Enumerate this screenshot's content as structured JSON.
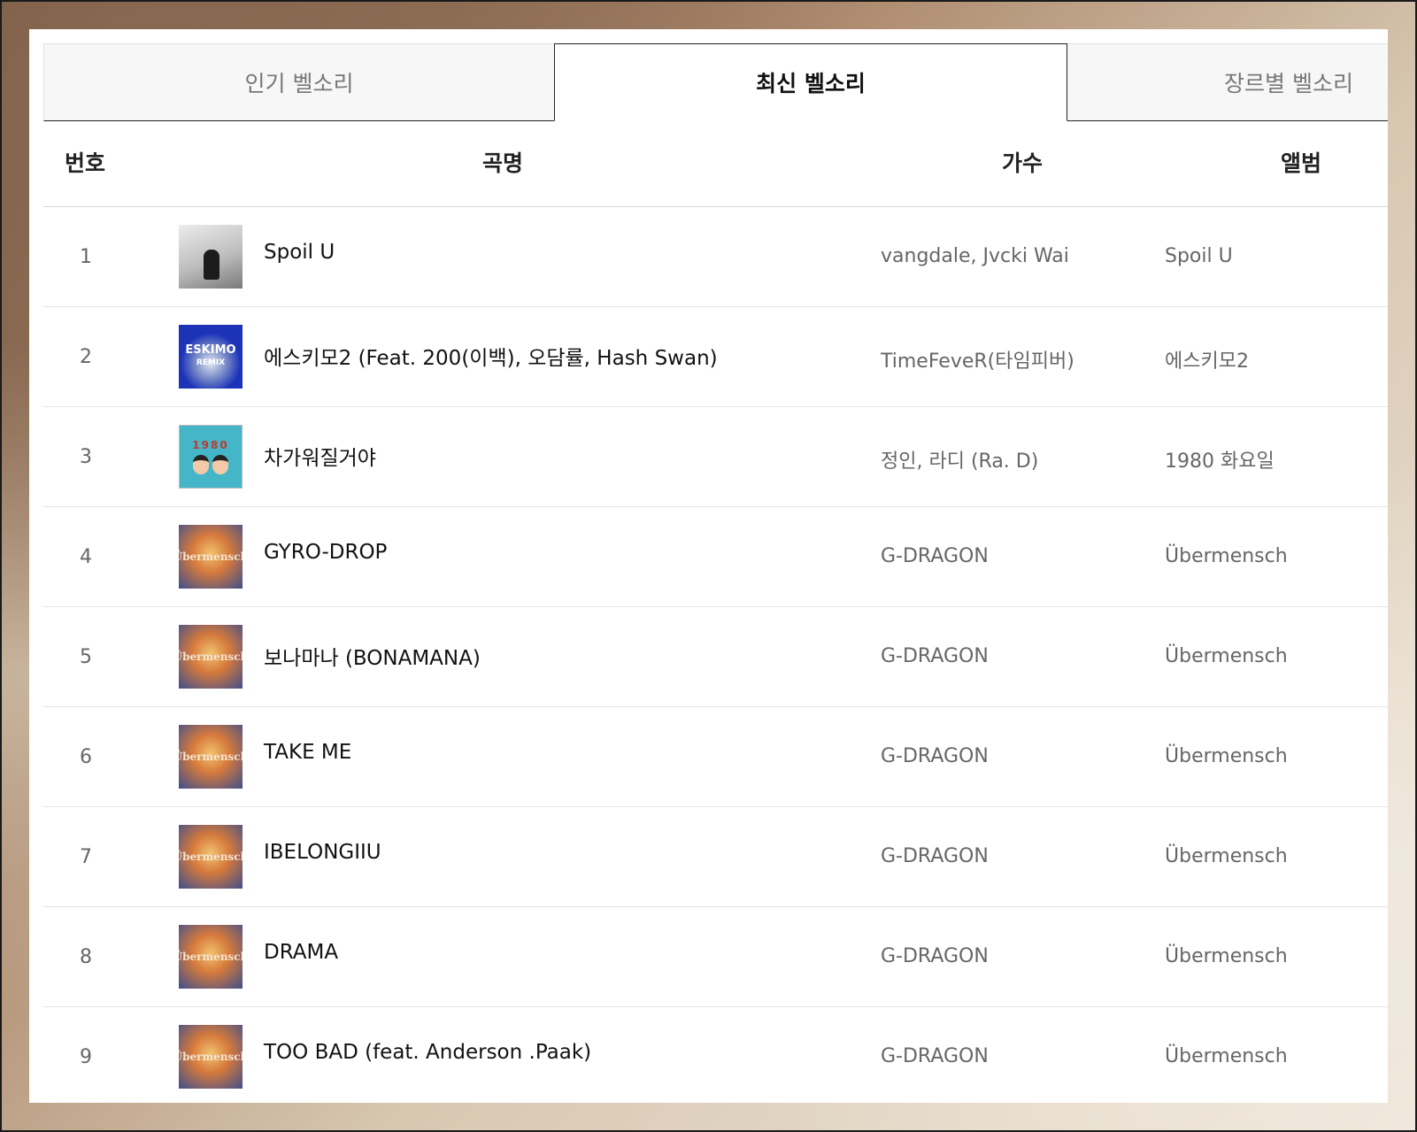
{
  "tabs": [
    {
      "label": "인기 벨소리"
    },
    {
      "label": "최신 벨소리"
    },
    {
      "label": "장르별 벨소리"
    }
  ],
  "columns": {
    "num": "번호",
    "title": "곡명",
    "artist": "가수",
    "album": "앨범"
  },
  "rows": [
    {
      "num": "1",
      "title": "Spoil U",
      "artist": "vangdale, Jvcki Wai",
      "album": "Spoil U",
      "art": "spoil"
    },
    {
      "num": "2",
      "title": "에스키모2 (Feat. 200(이백), 오담률, Hash Swan)",
      "artist": "TimeFeveR(타임피버)",
      "album": "에스키모2",
      "art": "eski",
      "art_text": [
        "ESKIMO",
        "REMIX"
      ]
    },
    {
      "num": "3",
      "title": "차가워질거야",
      "artist": "정인, 라디 (Ra. D)",
      "album": "1980 화요일",
      "art": "1980",
      "art_text": [
        "1980"
      ]
    },
    {
      "num": "4",
      "title": "GYRO-DROP",
      "artist": "G-DRAGON",
      "album": "Übermensch",
      "art": "uber",
      "art_text": [
        "Übermensch"
      ]
    },
    {
      "num": "5",
      "title": "보나마나 (BONAMANA)",
      "artist": "G-DRAGON",
      "album": "Übermensch",
      "art": "uber",
      "art_text": [
        "Übermensch"
      ]
    },
    {
      "num": "6",
      "title": "TAKE ME",
      "artist": "G-DRAGON",
      "album": "Übermensch",
      "art": "uber",
      "art_text": [
        "Übermensch"
      ]
    },
    {
      "num": "7",
      "title": "IBELONGIIU",
      "artist": "G-DRAGON",
      "album": "Übermensch",
      "art": "uber",
      "art_text": [
        "Übermensch"
      ]
    },
    {
      "num": "8",
      "title": "DRAMA",
      "artist": "G-DRAGON",
      "album": "Übermensch",
      "art": "uber",
      "art_text": [
        "Übermensch"
      ]
    },
    {
      "num": "9",
      "title": "TOO BAD (feat. Anderson .Paak)",
      "artist": "G-DRAGON",
      "album": "Übermensch",
      "art": "uber",
      "art_text": [
        "Übermensch"
      ]
    }
  ]
}
